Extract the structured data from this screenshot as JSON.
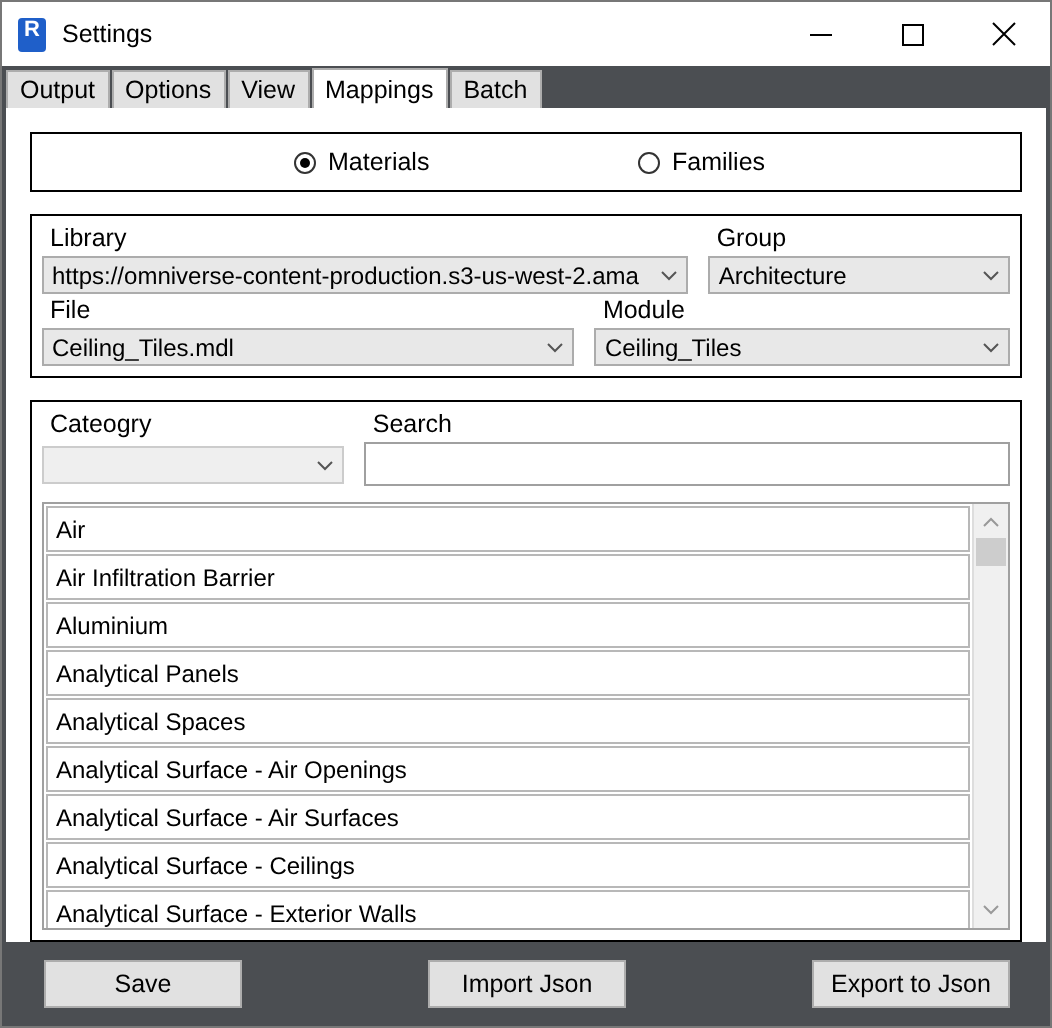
{
  "window": {
    "title": "Settings",
    "app_icon_letter": "R"
  },
  "tabs": [
    {
      "label": "Output",
      "selected": false
    },
    {
      "label": "Options",
      "selected": false
    },
    {
      "label": "View",
      "selected": false
    },
    {
      "label": "Mappings",
      "selected": true
    },
    {
      "label": "Batch",
      "selected": false
    }
  ],
  "mode": [
    {
      "label": "Materials",
      "selected": true
    },
    {
      "label": "Families",
      "selected": false
    }
  ],
  "library": {
    "label": "Library",
    "value": "https://omniverse-content-production.s3-us-west-2.ama"
  },
  "group": {
    "label": "Group",
    "value": "Architecture"
  },
  "file": {
    "label": "File",
    "value": "Ceiling_Tiles.mdl"
  },
  "module": {
    "label": "Module",
    "value": "Ceiling_Tiles"
  },
  "category": {
    "label": "Cateogry",
    "disabled": true
  },
  "search": {
    "label": "Search"
  },
  "list_items": [
    "Air",
    "Air Infiltration Barrier",
    "Aluminium",
    "Analytical Panels",
    "Analytical Spaces",
    "Analytical Surface - Air Openings",
    "Analytical Surface - Air Surfaces",
    "Analytical Surface - Ceilings",
    "Analytical Surface - Exterior Walls"
  ],
  "buttons": [
    "Save",
    "Import Json",
    "Export to Json"
  ]
}
